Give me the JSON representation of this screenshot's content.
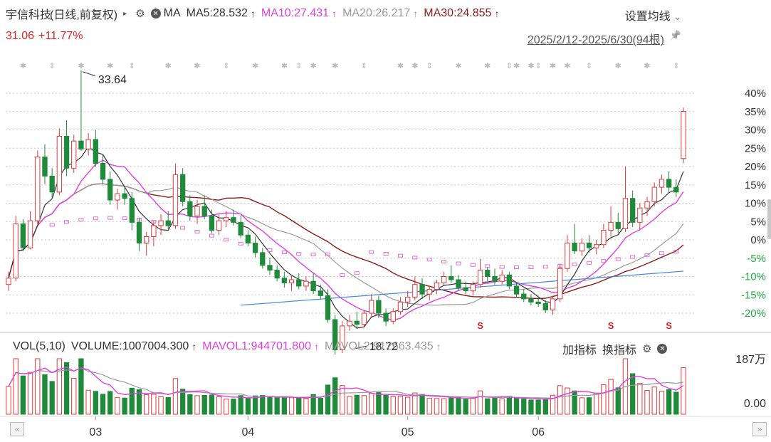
{
  "header": {
    "stock_name": "宇信科技",
    "mode": "(日线,前复权)",
    "expand_glyph": "▸",
    "gear_glyph": "⚙",
    "close_glyph": "✕",
    "ma_label": "MA",
    "ma5": "MA5:28.532",
    "ma10": "MA10:27.431",
    "ma20": "MA20:26.217",
    "ma30": "MA30:24.855",
    "up_arrow": "↑",
    "settings_label": "设置均线",
    "settings_caret": "⌄"
  },
  "price": {
    "last": "31.06",
    "change_pct": "+11.77%"
  },
  "range_label": "2025/2/12-2025/6/30(94根)",
  "pin_glyph": "📌",
  "price_chart": {
    "high_label": "33.64",
    "low_label": "18.72",
    "y_ticks": [
      "40%",
      "35%",
      "30%",
      "25%",
      "20%",
      "15%",
      "10%",
      "5%",
      "0%",
      "-5%",
      "-10%",
      "-15%",
      "-20%"
    ],
    "x_ticks": [
      "03",
      "04",
      "05",
      "06"
    ],
    "s_marker": "S"
  },
  "volume": {
    "title": "VOL(5,10)",
    "volume_value": "VOLUME:1007004.300",
    "mavol1": "MAVOL1:944701.800",
    "mavol2": "MAVOL2:912663.435",
    "up_arrow": "↑",
    "add_indicator": "加指标",
    "switch_indicator": "换指标",
    "y_max_label": "187万",
    "y_min_label": "0.00"
  },
  "scroll": {
    "left_glyph": "«",
    "right_glyph": "»"
  },
  "colors": {
    "up": "#e03a3a",
    "down": "#1f8a3a",
    "ma5": "#333333",
    "ma10": "#e040e0",
    "ma20": "#9a9a9a",
    "ma30": "#8b1a1a",
    "blue": "#4a86d8",
    "pink": "#e070d0",
    "grid": "#c8c8c8",
    "pct_pos": "#333333",
    "pct_neg": "#22aa44"
  },
  "chart_data": {
    "type": "candlestick",
    "candles": [
      [
        20.2,
        21.0,
        19.8,
        20.6
      ],
      [
        20.6,
        24.5,
        20.4,
        24.0
      ],
      [
        24.0,
        24.3,
        22.3,
        22.5
      ],
      [
        22.5,
        24.8,
        22.4,
        24.2
      ],
      [
        24.2,
        28.6,
        24.0,
        28.2
      ],
      [
        28.2,
        29.0,
        26.5,
        27.0
      ],
      [
        27.0,
        27.5,
        25.6,
        26.0
      ],
      [
        26.0,
        30.0,
        25.8,
        29.5
      ],
      [
        29.5,
        30.5,
        27.0,
        27.5
      ],
      [
        27.5,
        29.6,
        27.2,
        29.2
      ],
      [
        29.2,
        33.64,
        28.6,
        28.7
      ],
      [
        28.7,
        29.7,
        28.3,
        29.3
      ],
      [
        29.3,
        29.9,
        27.6,
        27.8
      ],
      [
        27.8,
        28.3,
        26.5,
        26.8
      ],
      [
        26.8,
        27.3,
        25.2,
        25.5
      ],
      [
        25.5,
        26.2,
        24.9,
        25.9
      ],
      [
        25.9,
        26.4,
        25.2,
        25.6
      ],
      [
        25.6,
        26.0,
        23.6,
        24.1
      ],
      [
        24.1,
        24.4,
        22.3,
        22.8
      ],
      [
        22.8,
        23.5,
        22.0,
        23.2
      ],
      [
        23.2,
        24.2,
        22.6,
        23.9
      ],
      [
        23.9,
        24.6,
        23.3,
        24.2
      ],
      [
        24.2,
        24.8,
        23.6,
        23.9
      ],
      [
        23.9,
        27.8,
        23.7,
        27.1
      ],
      [
        27.1,
        27.5,
        25.1,
        25.4
      ],
      [
        25.4,
        25.8,
        24.2,
        24.5
      ],
      [
        24.5,
        25.5,
        24.0,
        25.1
      ],
      [
        25.1,
        25.8,
        24.3,
        24.5
      ],
      [
        24.5,
        24.9,
        23.4,
        23.6
      ],
      [
        23.6,
        24.6,
        23.3,
        24.2
      ],
      [
        24.2,
        24.8,
        23.8,
        24.4
      ],
      [
        24.4,
        24.9,
        23.9,
        24.1
      ],
      [
        24.1,
        24.5,
        23.1,
        23.3
      ],
      [
        23.3,
        23.6,
        22.6,
        22.8
      ],
      [
        22.8,
        23.2,
        21.9,
        22.2
      ],
      [
        22.2,
        22.5,
        21.2,
        21.4
      ],
      [
        21.4,
        21.9,
        20.8,
        21.1
      ],
      [
        21.1,
        21.4,
        20.4,
        20.6
      ],
      [
        20.6,
        21.0,
        20.0,
        20.3
      ],
      [
        20.3,
        20.8,
        19.8,
        20.5
      ],
      [
        20.5,
        20.9,
        19.9,
        20.1
      ],
      [
        20.1,
        20.7,
        19.8,
        20.4
      ],
      [
        20.4,
        20.9,
        19.6,
        19.8
      ],
      [
        19.8,
        20.2,
        19.3,
        19.5
      ],
      [
        19.5,
        19.9,
        17.8,
        18.0
      ],
      [
        18.0,
        18.3,
        15.8,
        16.1
      ],
      [
        16.1,
        17.9,
        15.9,
        17.6
      ],
      [
        17.6,
        18.3,
        17.3,
        17.9
      ],
      [
        17.9,
        18.5,
        17.4,
        17.7
      ],
      [
        17.7,
        18.6,
        17.5,
        18.4
      ],
      [
        18.4,
        19.6,
        18.2,
        19.2
      ],
      [
        19.2,
        19.5,
        18.1,
        18.4
      ],
      [
        18.4,
        18.7,
        17.6,
        17.9
      ],
      [
        17.9,
        18.7,
        17.7,
        18.5
      ],
      [
        18.5,
        19.4,
        18.3,
        19.1
      ],
      [
        19.1,
        19.8,
        18.8,
        19.4
      ],
      [
        19.4,
        20.7,
        19.2,
        20.2
      ],
      [
        20.2,
        20.6,
        19.3,
        19.6
      ],
      [
        19.6,
        20.1,
        19.2,
        19.9
      ],
      [
        19.9,
        20.5,
        19.6,
        20.3
      ],
      [
        20.3,
        21.0,
        20.1,
        20.7
      ],
      [
        20.7,
        21.4,
        20.3,
        20.5
      ],
      [
        20.5,
        20.8,
        19.8,
        20.0
      ],
      [
        20.0,
        20.4,
        19.6,
        19.8
      ],
      [
        19.8,
        20.4,
        19.5,
        20.2
      ],
      [
        20.2,
        21.8,
        20.0,
        21.1
      ],
      [
        21.1,
        21.3,
        20.4,
        20.7
      ],
      [
        20.7,
        21.2,
        20.2,
        20.4
      ],
      [
        20.4,
        21.1,
        20.2,
        20.8
      ],
      [
        20.8,
        21.0,
        19.9,
        20.1
      ],
      [
        20.1,
        20.3,
        19.4,
        19.6
      ],
      [
        19.6,
        19.9,
        19.1,
        19.3
      ],
      [
        19.3,
        19.6,
        18.9,
        19.1
      ],
      [
        19.1,
        19.5,
        18.8,
        19.0
      ],
      [
        19.0,
        19.2,
        18.4,
        18.6
      ],
      [
        18.6,
        19.5,
        18.3,
        19.3
      ],
      [
        19.3,
        21.5,
        19.1,
        21.2
      ],
      [
        21.2,
        23.3,
        21.0,
        22.8
      ],
      [
        22.8,
        24.0,
        22.1,
        22.3
      ],
      [
        22.3,
        23.1,
        22.0,
        22.8
      ],
      [
        22.8,
        23.3,
        22.2,
        22.5
      ],
      [
        22.5,
        23.0,
        22.1,
        22.7
      ],
      [
        22.7,
        24.0,
        22.5,
        23.6
      ],
      [
        23.6,
        25.1,
        23.2,
        24.1
      ],
      [
        24.1,
        24.7,
        23.4,
        23.7
      ],
      [
        23.7,
        27.6,
        23.5,
        25.6
      ],
      [
        25.6,
        26.1,
        23.8,
        24.1
      ],
      [
        24.1,
        25.3,
        23.6,
        25.0
      ],
      [
        25.0,
        25.7,
        24.5,
        25.4
      ],
      [
        25.4,
        26.6,
        25.1,
        26.3
      ],
      [
        26.3,
        27.1,
        25.9,
        26.8
      ],
      [
        26.8,
        27.3,
        26.0,
        26.3
      ],
      [
        26.3,
        26.8,
        25.7,
        26.0
      ],
      [
        28.1,
        31.3,
        27.8,
        31.06
      ]
    ],
    "y_axis": "percent change relative to 23.0",
    "percent_range": [
      -20,
      40
    ],
    "x_ticks": [
      "03",
      "04",
      "05",
      "06"
    ],
    "volume_max": 1870000,
    "volume_min": 0,
    "mavol1": 944701.8,
    "mavol2": 912663.435
  }
}
